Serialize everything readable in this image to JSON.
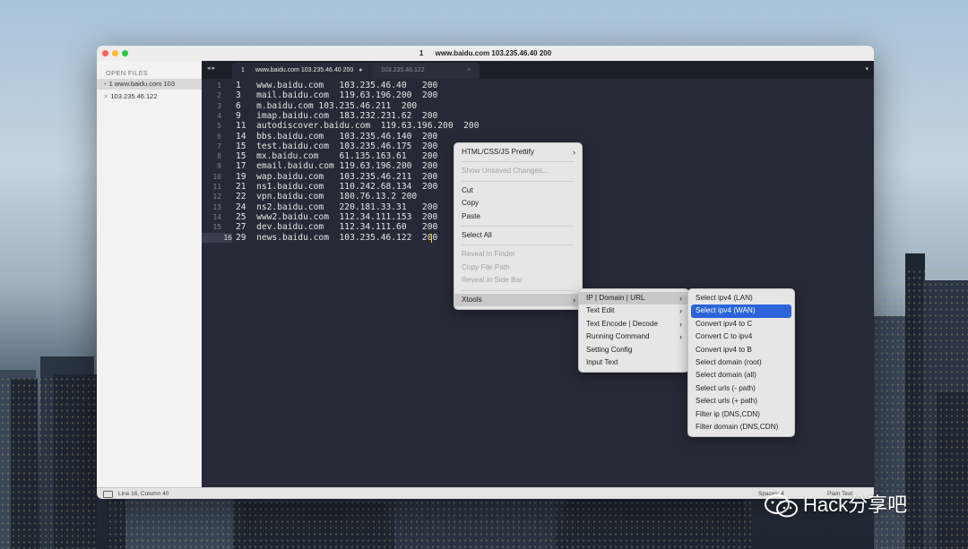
{
  "window": {
    "title_number": "1",
    "title_text": "www.baidu.com  103.235.46.40   200"
  },
  "sidebar": {
    "header": "OPEN FILES",
    "files": [
      {
        "marker": "•",
        "label": "1      www.baidu.com     103"
      },
      {
        "marker": "×",
        "label": "103.235.46.122"
      }
    ]
  },
  "tabs": {
    "nav": "◂ ▸",
    "active": {
      "number": "1",
      "label": "www.baidu.com 103.235.46.40  200",
      "dirty": "●"
    },
    "inactive": {
      "label": "103.235.46.122",
      "close": "×"
    },
    "dropdown": "▾"
  },
  "editor": {
    "lines": [
      {
        "n": "1",
        "text": "1   www.baidu.com   103.235.46.40   200"
      },
      {
        "n": "2",
        "text": "3   mail.baidu.com  119.63.196.200  200"
      },
      {
        "n": "3",
        "text": "6   m.baidu.com 103.235.46.211  200"
      },
      {
        "n": "4",
        "text": "9   imap.baidu.com  183.232.231.62  200"
      },
      {
        "n": "5",
        "text": "11  autodiscover.baidu.com  119.63.196.200  200"
      },
      {
        "n": "6",
        "text": "14  bbs.baidu.com   103.235.46.140  200"
      },
      {
        "n": "7",
        "text": "15  test.baidu.com  103.235.46.175  200"
      },
      {
        "n": "8",
        "text": "15  mx.baidu.com    61.135.163.61   200"
      },
      {
        "n": "9",
        "text": "17  email.baidu.com 119.63.196.200  200"
      },
      {
        "n": "10",
        "text": "19  wap.baidu.com   103.235.46.211  200"
      },
      {
        "n": "11",
        "text": "21  ns1.baidu.com   110.242.68.134  200"
      },
      {
        "n": "12",
        "text": "22  vpn.baidu.com   180.76.13.2 200"
      },
      {
        "n": "13",
        "text": "24  ns2.baidu.com   220.181.33.31   200"
      },
      {
        "n": "14",
        "text": "25  www2.baidu.com  112.34.111.153  200"
      },
      {
        "n": "15",
        "text": "27  dev.baidu.com   112.34.111.60   200"
      },
      {
        "n": "16",
        "text": "29  news.baidu.com  103.235.46.122  200"
      }
    ],
    "current_line": "16"
  },
  "status": {
    "position": "Line 16, Column 40",
    "spaces": "Spaces: 4",
    "syntax": "Plain Text"
  },
  "context_menu": {
    "items": [
      {
        "label": "HTML/CSS/JS Prettify",
        "submenu": true,
        "disabled": false
      },
      {
        "sep": true
      },
      {
        "label": "Show Unsaved Changes...",
        "disabled": true
      },
      {
        "sep": true
      },
      {
        "label": "Cut",
        "disabled": false
      },
      {
        "label": "Copy",
        "disabled": false
      },
      {
        "label": "Paste",
        "disabled": false
      },
      {
        "sep": true
      },
      {
        "label": "Select All",
        "disabled": false
      },
      {
        "sep": true
      },
      {
        "label": "Reveal in Finder",
        "disabled": true
      },
      {
        "label": "Copy File Path",
        "disabled": true
      },
      {
        "label": "Reveal in Side Bar",
        "disabled": true
      },
      {
        "sep": true
      },
      {
        "label": "Xtools",
        "submenu": true,
        "disabled": false,
        "hover": true
      }
    ]
  },
  "xtools_menu": {
    "items": [
      {
        "label": "IP | Domain | URL",
        "submenu": true,
        "hover": true
      },
      {
        "label": "Text Edit",
        "submenu": true
      },
      {
        "label": "Text Encode | Decode",
        "submenu": true
      },
      {
        "label": "Running Command",
        "submenu": true
      },
      {
        "label": "Setting Config",
        "submenu": false
      },
      {
        "label": "Input Text",
        "submenu": false
      }
    ]
  },
  "ip_menu": {
    "items": [
      {
        "label": "Select ipv4 (LAN)"
      },
      {
        "label": "Select ipv4 (WAN)",
        "selected": true
      },
      {
        "label": "Convert ipv4 to C"
      },
      {
        "label": "Convert C to ipv4"
      },
      {
        "label": "Convert ipv4 to B"
      },
      {
        "label": "Select domain (root)"
      },
      {
        "label": "Select domain (all)"
      },
      {
        "label": "Select urls (- path)"
      },
      {
        "label": "Select urls (+ path)"
      },
      {
        "label": "Filter ip (DNS,CDN)"
      },
      {
        "label": "Filter domain (DNS,CDN)"
      }
    ]
  },
  "watermark": {
    "text": "Hack分享吧"
  },
  "colors": {
    "editor_bg": "#272936",
    "selection": "#2a64d8",
    "caret": "#ffcc00"
  }
}
